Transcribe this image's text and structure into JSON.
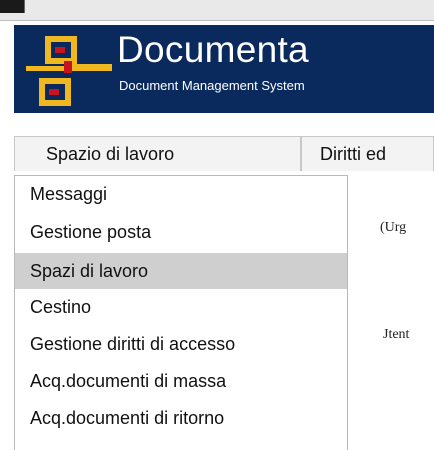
{
  "app": {
    "title": "Documenta",
    "subtitle": "Document Management System",
    "brand_color": "#0a2a5e",
    "logo_colors": {
      "primary": "#f0b820",
      "accent": "#c8141e"
    }
  },
  "tabs": [
    {
      "label": "Spazio di lavoro"
    },
    {
      "label": "Diritti ed"
    }
  ],
  "menu": {
    "items": [
      {
        "label": "Messaggi",
        "selected": false
      },
      {
        "label": "Gestione posta",
        "selected": false
      },
      {
        "label": "Spazi di lavoro",
        "selected": true
      },
      {
        "label": "Cestino",
        "selected": false
      },
      {
        "label": "Gestione diritti di accesso",
        "selected": false
      },
      {
        "label": "Acq.documenti di massa",
        "selected": false
      },
      {
        "label": "Acq.documenti di ritorno",
        "selected": false
      }
    ],
    "highlight_color": "#cfcfcf"
  },
  "background": {
    "text_1": "(Urg",
    "text_2": "Jtent"
  }
}
